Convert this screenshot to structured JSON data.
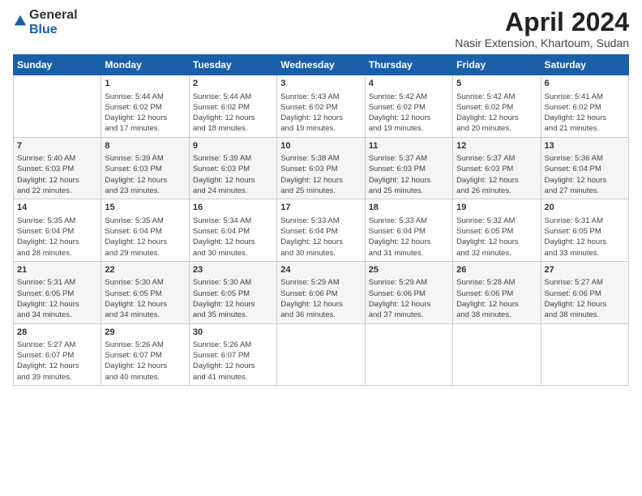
{
  "header": {
    "logo_general": "General",
    "logo_blue": "Blue",
    "title": "April 2024",
    "subtitle": "Nasir Extension, Khartoum, Sudan"
  },
  "days_of_week": [
    "Sunday",
    "Monday",
    "Tuesday",
    "Wednesday",
    "Thursday",
    "Friday",
    "Saturday"
  ],
  "weeks": [
    [
      {
        "day": "",
        "info": ""
      },
      {
        "day": "1",
        "info": "Sunrise: 5:44 AM\nSunset: 6:02 PM\nDaylight: 12 hours\nand 17 minutes."
      },
      {
        "day": "2",
        "info": "Sunrise: 5:44 AM\nSunset: 6:02 PM\nDaylight: 12 hours\nand 18 minutes."
      },
      {
        "day": "3",
        "info": "Sunrise: 5:43 AM\nSunset: 6:02 PM\nDaylight: 12 hours\nand 19 minutes."
      },
      {
        "day": "4",
        "info": "Sunrise: 5:42 AM\nSunset: 6:02 PM\nDaylight: 12 hours\nand 19 minutes."
      },
      {
        "day": "5",
        "info": "Sunrise: 5:42 AM\nSunset: 6:02 PM\nDaylight: 12 hours\nand 20 minutes."
      },
      {
        "day": "6",
        "info": "Sunrise: 5:41 AM\nSunset: 6:02 PM\nDaylight: 12 hours\nand 21 minutes."
      }
    ],
    [
      {
        "day": "7",
        "info": "Sunrise: 5:40 AM\nSunset: 6:03 PM\nDaylight: 12 hours\nand 22 minutes."
      },
      {
        "day": "8",
        "info": "Sunrise: 5:39 AM\nSunset: 6:03 PM\nDaylight: 12 hours\nand 23 minutes."
      },
      {
        "day": "9",
        "info": "Sunrise: 5:39 AM\nSunset: 6:03 PM\nDaylight: 12 hours\nand 24 minutes."
      },
      {
        "day": "10",
        "info": "Sunrise: 5:38 AM\nSunset: 6:03 PM\nDaylight: 12 hours\nand 25 minutes."
      },
      {
        "day": "11",
        "info": "Sunrise: 5:37 AM\nSunset: 6:03 PM\nDaylight: 12 hours\nand 25 minutes."
      },
      {
        "day": "12",
        "info": "Sunrise: 5:37 AM\nSunset: 6:03 PM\nDaylight: 12 hours\nand 26 minutes."
      },
      {
        "day": "13",
        "info": "Sunrise: 5:36 AM\nSunset: 6:04 PM\nDaylight: 12 hours\nand 27 minutes."
      }
    ],
    [
      {
        "day": "14",
        "info": "Sunrise: 5:35 AM\nSunset: 6:04 PM\nDaylight: 12 hours\nand 28 minutes."
      },
      {
        "day": "15",
        "info": "Sunrise: 5:35 AM\nSunset: 6:04 PM\nDaylight: 12 hours\nand 29 minutes."
      },
      {
        "day": "16",
        "info": "Sunrise: 5:34 AM\nSunset: 6:04 PM\nDaylight: 12 hours\nand 30 minutes."
      },
      {
        "day": "17",
        "info": "Sunrise: 5:33 AM\nSunset: 6:04 PM\nDaylight: 12 hours\nand 30 minutes."
      },
      {
        "day": "18",
        "info": "Sunrise: 5:33 AM\nSunset: 6:04 PM\nDaylight: 12 hours\nand 31 minutes."
      },
      {
        "day": "19",
        "info": "Sunrise: 5:32 AM\nSunset: 6:05 PM\nDaylight: 12 hours\nand 32 minutes."
      },
      {
        "day": "20",
        "info": "Sunrise: 5:31 AM\nSunset: 6:05 PM\nDaylight: 12 hours\nand 33 minutes."
      }
    ],
    [
      {
        "day": "21",
        "info": "Sunrise: 5:31 AM\nSunset: 6:05 PM\nDaylight: 12 hours\nand 34 minutes."
      },
      {
        "day": "22",
        "info": "Sunrise: 5:30 AM\nSunset: 6:05 PM\nDaylight: 12 hours\nand 34 minutes."
      },
      {
        "day": "23",
        "info": "Sunrise: 5:30 AM\nSunset: 6:05 PM\nDaylight: 12 hours\nand 35 minutes."
      },
      {
        "day": "24",
        "info": "Sunrise: 5:29 AM\nSunset: 6:06 PM\nDaylight: 12 hours\nand 36 minutes."
      },
      {
        "day": "25",
        "info": "Sunrise: 5:29 AM\nSunset: 6:06 PM\nDaylight: 12 hours\nand 37 minutes."
      },
      {
        "day": "26",
        "info": "Sunrise: 5:28 AM\nSunset: 6:06 PM\nDaylight: 12 hours\nand 38 minutes."
      },
      {
        "day": "27",
        "info": "Sunrise: 5:27 AM\nSunset: 6:06 PM\nDaylight: 12 hours\nand 38 minutes."
      }
    ],
    [
      {
        "day": "28",
        "info": "Sunrise: 5:27 AM\nSunset: 6:07 PM\nDaylight: 12 hours\nand 39 minutes."
      },
      {
        "day": "29",
        "info": "Sunrise: 5:26 AM\nSunset: 6:07 PM\nDaylight: 12 hours\nand 40 minutes."
      },
      {
        "day": "30",
        "info": "Sunrise: 5:26 AM\nSunset: 6:07 PM\nDaylight: 12 hours\nand 41 minutes."
      },
      {
        "day": "",
        "info": ""
      },
      {
        "day": "",
        "info": ""
      },
      {
        "day": "",
        "info": ""
      },
      {
        "day": "",
        "info": ""
      }
    ]
  ]
}
